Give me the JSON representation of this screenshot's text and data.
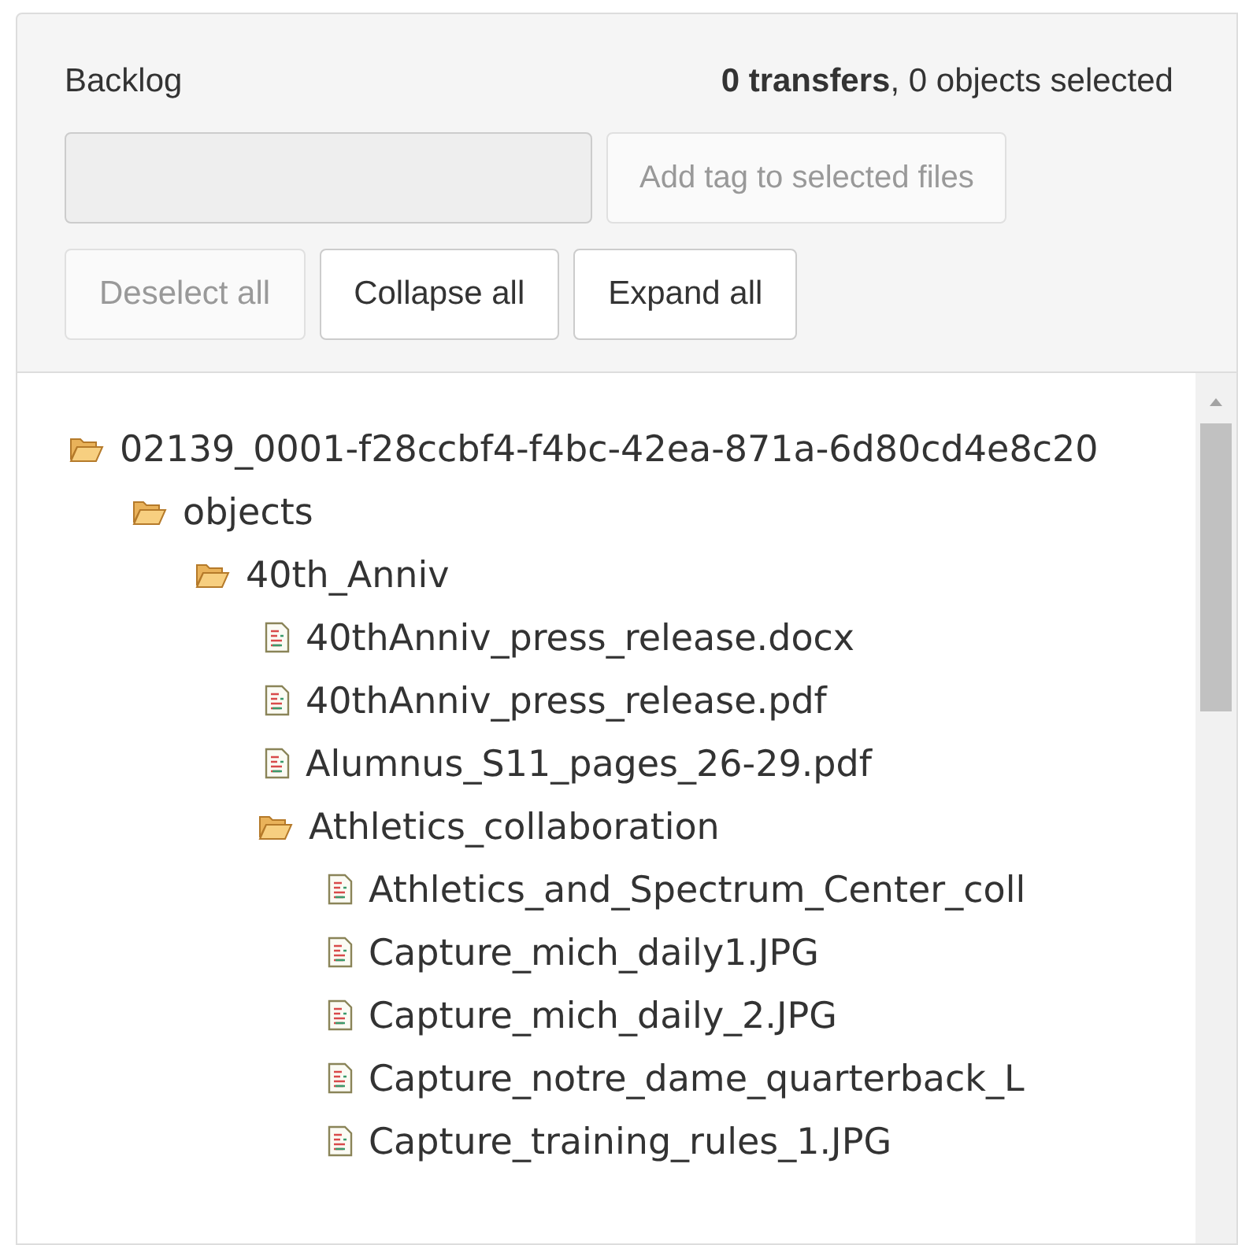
{
  "panel": {
    "title": "Backlog",
    "summary": "**0 transfers**, 0 objects selected"
  },
  "tag_field": {
    "disabled": true
  },
  "tag_button": {
    "label": "Add tag to selected files",
    "disabled": true
  },
  "buttons": [
    {
      "label": "Deselect all",
      "disabled": true
    },
    {
      "label": "Collapse all",
      "disabled": false
    },
    {
      "label": "Expand all",
      "disabled": false
    }
  ],
  "tree": [
    {
      "kind": "folder",
      "label": "02139_0001-f28ccbf4-f4bc-42ea-871a-6d80cd4e8c20",
      "expanded": true,
      "children": [
        {
          "kind": "folder",
          "label": "objects",
          "expanded": true,
          "children": [
            {
              "kind": "folder",
              "label": "40th_Anniv",
              "expanded": true,
              "children": [
                {
                  "kind": "file",
                  "label": "40thAnniv_press_release.docx"
                },
                {
                  "kind": "file",
                  "label": "40thAnniv_press_release.pdf"
                },
                {
                  "kind": "file",
                  "label": "Alumnus_S11_pages_26-29.pdf"
                },
                {
                  "kind": "folder",
                  "label": "Athletics_collaboration",
                  "expanded": true,
                  "children": [
                    {
                      "kind": "file",
                      "label": "Athletics_and_Spectrum_Center_coll"
                    },
                    {
                      "kind": "file",
                      "label": "Capture_mich_daily1.JPG"
                    },
                    {
                      "kind": "file",
                      "label": "Capture_mich_daily_2.JPG"
                    },
                    {
                      "kind": "file",
                      "label": "Capture_notre_dame_quarterback_L"
                    },
                    {
                      "kind": "file",
                      "label": "Capture_training_rules_1.JPG"
                    }
                  ]
                }
              ]
            }
          ]
        }
      ]
    }
  ]
}
